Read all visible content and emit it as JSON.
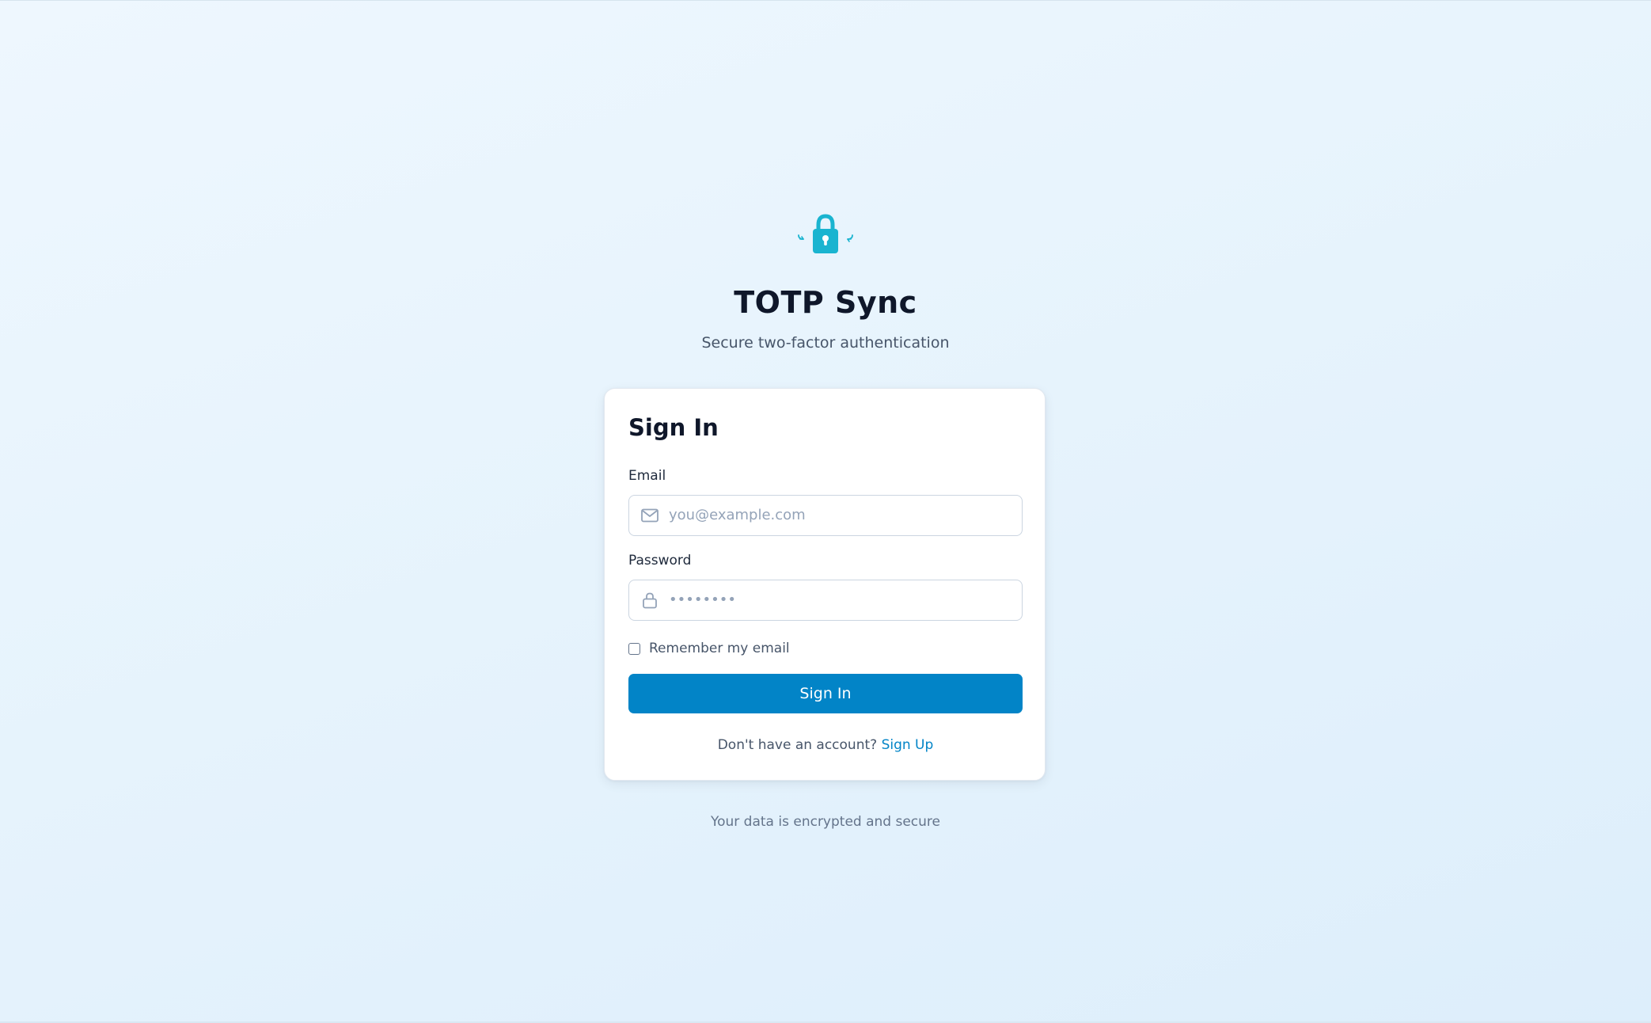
{
  "app": {
    "title": "TOTP Sync",
    "subtitle": "Secure two-factor authentication",
    "logo_icon": "lock-sync-icon"
  },
  "signin_card": {
    "title": "Sign In",
    "email": {
      "label": "Email",
      "value": "",
      "placeholder": "you@example.com",
      "icon": "mail-icon"
    },
    "password": {
      "label": "Password",
      "value": "",
      "placeholder": "••••••••",
      "icon": "lock-icon"
    },
    "remember": {
      "label": "Remember my email",
      "checked": false
    },
    "submit_label": "Sign In",
    "signup_prompt": "Don't have an account?",
    "signup_link_label": "Sign Up"
  },
  "footer": {
    "note": "Your data is encrypted and secure"
  },
  "colors": {
    "accent": "#0284c7",
    "logo": "#1ab4d0",
    "background": "#eaf5fd"
  }
}
